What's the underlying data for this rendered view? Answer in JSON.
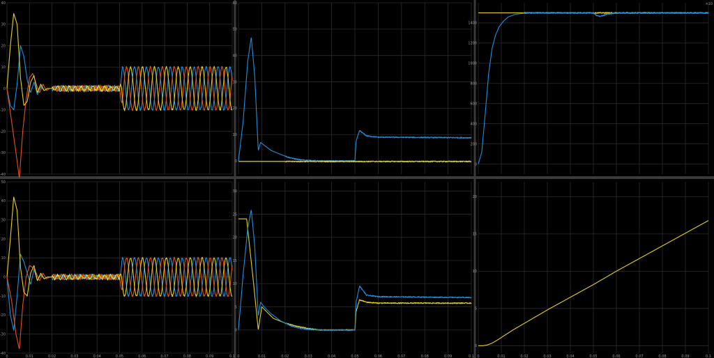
{
  "window": {
    "background": "#000000",
    "divider": "#3a3a3a",
    "grid": "#2b2b2b",
    "tick_color": "#9a9a9a"
  },
  "colors": {
    "blue": "#1f8fe0",
    "orange": "#e8501c",
    "yellow": "#e6d21a"
  },
  "chart_data": [
    {
      "id": "p1",
      "type": "line",
      "xlim": [
        0,
        0.1
      ],
      "ylim": [
        -40,
        40
      ],
      "yticks": [
        -40,
        -30,
        -20,
        -10,
        0,
        10,
        20,
        30,
        40
      ],
      "xticks": [
        0,
        0.01,
        0.02,
        0.03,
        0.04,
        0.05,
        0.06,
        0.07,
        0.08,
        0.09,
        0.1
      ],
      "xlabels": [],
      "series": [
        {
          "color": "blue",
          "x": [
            0,
            0.0015,
            0.003,
            0.0045,
            0.006,
            0.0075,
            0.009,
            0.0105,
            0.012,
            0.0135,
            0.015,
            0.0165,
            0.018
          ],
          "y": [
            0,
            -8,
            -10,
            2,
            20,
            15,
            4,
            -2,
            3,
            -3,
            1,
            -1,
            0
          ]
        },
        {
          "color": "orange",
          "x": [
            0,
            0.002,
            0.004,
            0.0055,
            0.007,
            0.0085,
            0.01,
            0.0115,
            0.013,
            0.0145,
            0.016,
            0.0175,
            0.019
          ],
          "y": [
            0,
            -15,
            -30,
            -42,
            -20,
            -5,
            5,
            7,
            2,
            -2,
            2,
            -1,
            0
          ]
        },
        {
          "color": "yellow",
          "x": [
            0,
            0.0015,
            0.003,
            0.0045,
            0.006,
            0.0075,
            0.009,
            0.0105,
            0.012,
            0.0135,
            0.015,
            0.0165,
            0.018
          ],
          "y": [
            0,
            20,
            35,
            30,
            5,
            -8,
            -6,
            3,
            6,
            -2,
            2,
            -1,
            0
          ]
        }
      ],
      "steady": {
        "x0": 0.02,
        "x1": 0.05,
        "amp": 1
      },
      "sine": {
        "x0": 0.05,
        "x1": 0.1,
        "amp": 10,
        "period": 0.0053
      }
    },
    {
      "id": "p2",
      "type": "line",
      "xlim": [
        0,
        0.1
      ],
      "ylim": [
        -5,
        60
      ],
      "yticks": [
        0,
        10,
        20,
        30,
        40,
        50,
        60
      ],
      "xticks": [
        0,
        0.01,
        0.02,
        0.03,
        0.04,
        0.05,
        0.06,
        0.07,
        0.08,
        0.09,
        0.1
      ],
      "xlabels": [],
      "series": [
        {
          "color": "blue",
          "x": [
            0,
            0.002,
            0.004,
            0.0055,
            0.007,
            0.0085,
            0.0095,
            0.011,
            0.014,
            0.018,
            0.022,
            0.026,
            0.03,
            0.035,
            0.05,
            0.0505,
            0.052,
            0.055,
            0.06,
            0.1
          ],
          "y": [
            0,
            15,
            38,
            47,
            32,
            4,
            7,
            6,
            4,
            2.5,
            1.2,
            0.5,
            0.2,
            0,
            0,
            7.5,
            11.5,
            9.5,
            9,
            8.8
          ]
        },
        {
          "color": "yellow",
          "x": [
            0,
            0.1
          ],
          "y": [
            -0.2,
            -0.2
          ]
        }
      ]
    },
    {
      "id": "p3",
      "type": "line",
      "xlim": [
        0,
        0.1
      ],
      "ylim": [
        -100,
        1600
      ],
      "yticks": [
        0,
        200,
        400,
        600,
        800,
        1000,
        1200,
        1400
      ],
      "xticks": [
        0,
        0.01,
        0.02,
        0.03,
        0.04,
        0.05,
        0.06,
        0.07,
        0.08,
        0.09,
        0.1
      ],
      "xlabels": [],
      "corner_label": "×10",
      "series": [
        {
          "color": "yellow",
          "x": [
            0,
            0.1
          ],
          "y": [
            1500,
            1500
          ]
        },
        {
          "color": "blue",
          "x": [
            0,
            0.0015,
            0.003,
            0.0045,
            0.006,
            0.0075,
            0.009,
            0.011,
            0.013,
            0.016,
            0.02,
            0.025,
            0.05,
            0.0515,
            0.053,
            0.056,
            0.06,
            0.1
          ],
          "y": [
            0,
            120,
            500,
            900,
            1150,
            1280,
            1360,
            1420,
            1460,
            1485,
            1496,
            1500,
            1500,
            1472,
            1465,
            1488,
            1498,
            1500
          ]
        }
      ]
    },
    {
      "id": "p4",
      "type": "line",
      "xlim": [
        0,
        0.1
      ],
      "ylim": [
        -40,
        50
      ],
      "yticks": [
        -40,
        -30,
        -20,
        -10,
        0,
        10,
        20,
        30,
        40,
        50
      ],
      "xticks": [
        0,
        0.01,
        0.02,
        0.03,
        0.04,
        0.05,
        0.06,
        0.07,
        0.08,
        0.09,
        0.1
      ],
      "xlabels": [
        "0",
        "0.01",
        "0.02",
        "0.03",
        "0.04",
        "0.05",
        "0.06",
        "0.07",
        "0.08",
        "0.09",
        "0.1"
      ],
      "series": [
        {
          "color": "blue",
          "x": [
            0,
            0.0015,
            0.003,
            0.0045,
            0.006,
            0.0075,
            0.009,
            0.0105,
            0.012,
            0.0135,
            0.015,
            0.0165,
            0.018
          ],
          "y": [
            0,
            -20,
            -28,
            -10,
            12,
            8,
            2,
            -4,
            4,
            -2,
            1,
            -1,
            0
          ]
        },
        {
          "color": "orange",
          "x": [
            0,
            0.002,
            0.004,
            0.0055,
            0.007,
            0.0085,
            0.01,
            0.0115,
            0.013,
            0.0145,
            0.016,
            0.0175,
            0.019
          ],
          "y": [
            0,
            -12,
            -30,
            -38,
            -15,
            0,
            6,
            5,
            2,
            -2,
            2,
            -1,
            0
          ]
        },
        {
          "color": "yellow",
          "x": [
            0,
            0.0015,
            0.003,
            0.0045,
            0.006,
            0.0075,
            0.009,
            0.0105,
            0.012,
            0.0135,
            0.015,
            0.0165,
            0.018
          ],
          "y": [
            0,
            20,
            42,
            35,
            5,
            -8,
            -10,
            2,
            6,
            -2,
            2,
            -1,
            0
          ]
        }
      ],
      "steady": {
        "x0": 0.02,
        "x1": 0.05,
        "amp": 1
      },
      "sine": {
        "x0": 0.05,
        "x1": 0.1,
        "amp": 10,
        "period": 0.0053
      }
    },
    {
      "id": "p5",
      "type": "line",
      "xlim": [
        0,
        0.1
      ],
      "ylim": [
        -5,
        32
      ],
      "yticks": [
        0,
        5,
        10,
        15,
        20,
        25,
        30
      ],
      "xticks": [
        0,
        0.01,
        0.02,
        0.03,
        0.04,
        0.05,
        0.06,
        0.07,
        0.08,
        0.09,
        0.1
      ],
      "xlabels": [
        "0",
        "0.01",
        "0.02",
        "0.03",
        "0.04",
        "0.05",
        "0.06",
        "0.07",
        "0.08",
        "0.09",
        "0.1"
      ],
      "series": [
        {
          "color": "yellow",
          "x": [
            0,
            0.0035,
            0.0065,
            0.0085,
            0.01,
            0.012,
            0.015,
            0.02,
            0.025,
            0.03,
            0.035,
            0.05,
            0.0505,
            0.052,
            0.055,
            0.06,
            0.1
          ],
          "y": [
            24,
            24,
            10,
            0,
            5,
            4,
            2.5,
            1.5,
            0.8,
            0.3,
            0,
            0,
            4,
            6.5,
            6,
            5.8,
            5.8
          ]
        },
        {
          "color": "blue",
          "x": [
            0,
            0.002,
            0.004,
            0.0055,
            0.007,
            0.0085,
            0.0095,
            0.011,
            0.014,
            0.018,
            0.022,
            0.026,
            0.03,
            0.035,
            0.05,
            0.0505,
            0.052,
            0.055,
            0.06,
            0.1
          ],
          "y": [
            0,
            12,
            22,
            26,
            18,
            3,
            6,
            5,
            3.5,
            2,
            1,
            0.4,
            0.1,
            0,
            0,
            6,
            9.5,
            7.5,
            7.2,
            7
          ]
        }
      ]
    },
    {
      "id": "p6",
      "type": "line",
      "xlim": [
        0,
        0.1
      ],
      "ylim": [
        -1,
        22
      ],
      "yticks": [
        0,
        5,
        10,
        15,
        20
      ],
      "xticks": [
        0,
        0.01,
        0.02,
        0.03,
        0.04,
        0.05,
        0.06,
        0.07,
        0.08,
        0.09,
        0.1
      ],
      "xlabels": [
        "0",
        "0.01",
        "0.02",
        "0.03",
        "0.04",
        "0.05",
        "0.06",
        "0.07",
        "0.08",
        "0.09",
        "0.1"
      ],
      "series": [
        {
          "color": "yellow",
          "x": [
            0,
            0.002,
            0.004,
            0.006,
            0.008,
            0.01,
            0.012,
            0.015,
            0.02,
            0.03,
            0.04,
            0.05,
            0.06,
            0.07,
            0.08,
            0.09,
            0.1
          ],
          "y": [
            0,
            0,
            0.1,
            0.35,
            0.7,
            1.1,
            1.5,
            2.1,
            3.0,
            4.8,
            6.5,
            8.2,
            10.0,
            11.7,
            13.4,
            15.1,
            16.8
          ]
        }
      ]
    }
  ]
}
